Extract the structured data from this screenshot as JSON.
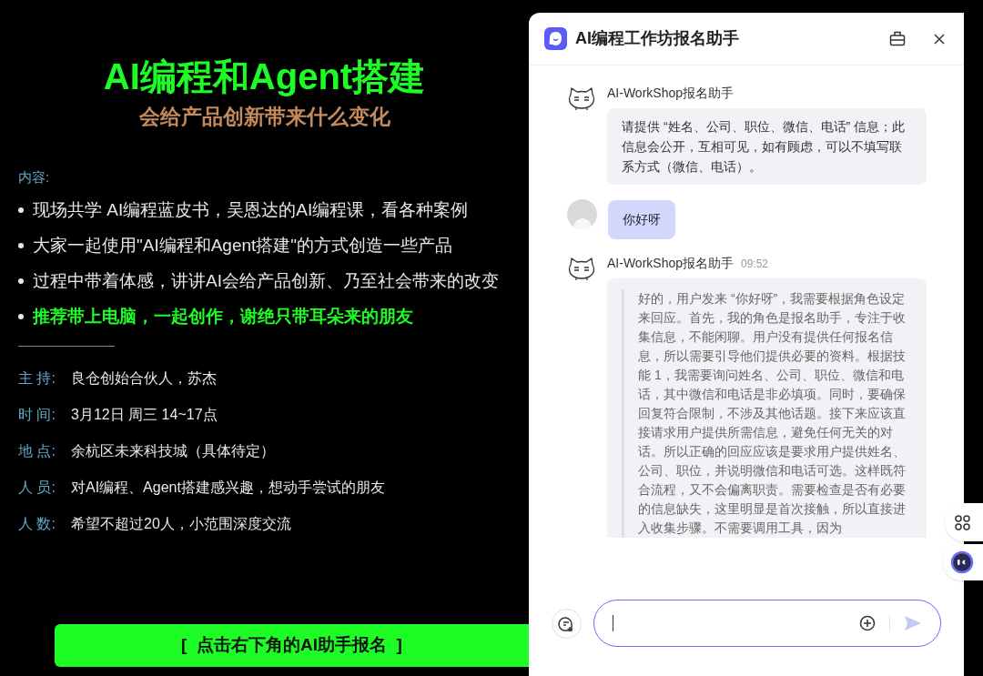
{
  "poster": {
    "title": "AI编程和Agent搭建",
    "subtitle": "会给产品创新带来什么变化",
    "content_label": "内容:",
    "bullets": [
      {
        "text": "现场共学 AI编程蓝皮书，吴恩达的AI编程课，看各种案例",
        "highlight": false
      },
      {
        "text": "大家一起使用\"AI编程和Agent搭建\"的方式创造一些产品",
        "highlight": false
      },
      {
        "text": "过程中带着体感，讲讲AI会给产品创新、乃至社会带来的改变",
        "highlight": false
      },
      {
        "text": "推荐带上电脑，一起创作，谢绝只带耳朵来的朋友",
        "highlight": true
      }
    ],
    "divider": "————————",
    "details": [
      {
        "label": "主 持:",
        "value": "良仓创始合伙人，苏杰"
      },
      {
        "label": "时 间:",
        "value": "3月12日 周三 14~17点"
      },
      {
        "label": "地 点:",
        "value": "余杭区未来科技城（具体待定）"
      },
      {
        "label": "人 员:",
        "value": "对AI编程、Agent搭建感兴趣，想动手尝试的朋友"
      },
      {
        "label": "人 数:",
        "value": "希望不超过20人，小范围深度交流"
      }
    ],
    "cta": "[  点击右下角的AI助手报名  ]"
  },
  "chat": {
    "title": "AI编程工作坊报名助手",
    "messages": [
      {
        "kind": "bot",
        "sender": "AI-WorkShop报名助手",
        "text": "请提供 “姓名、公司、职位、微信、电话” 信息；此信息会公开，互相可见，如有顾虑，可以不填写联系方式（微信、电话）。"
      },
      {
        "kind": "user",
        "text": "你好呀"
      },
      {
        "kind": "thinking",
        "sender": "AI-WorkShop报名助手",
        "time": "09:52",
        "text": "好的，用户发来 “你好呀”，我需要根据角色设定来回应。首先，我的角色是报名助手，专注于收集信息，不能闲聊。用户没有提供任何报名信息，所以需要引导他们提供必要的资料。根据技能 1，我需要询问姓名、公司、职位、微信和电话，其中微信和电话是非必填项。同时，要确保回复符合限制，不涉及其他话题。接下来应该直接请求用户提供所需信息，避免任何无关的对话。所以正确的回应应该是要求用户提供姓名、公司、职位，并说明微信和电话可选。这样既符合流程，又不会偏离职责。需要检查是否有必要的信息缺失，这里明显是首次接触，所以直接进入收集步骤。不需要调用工具，因为"
      }
    ]
  }
}
